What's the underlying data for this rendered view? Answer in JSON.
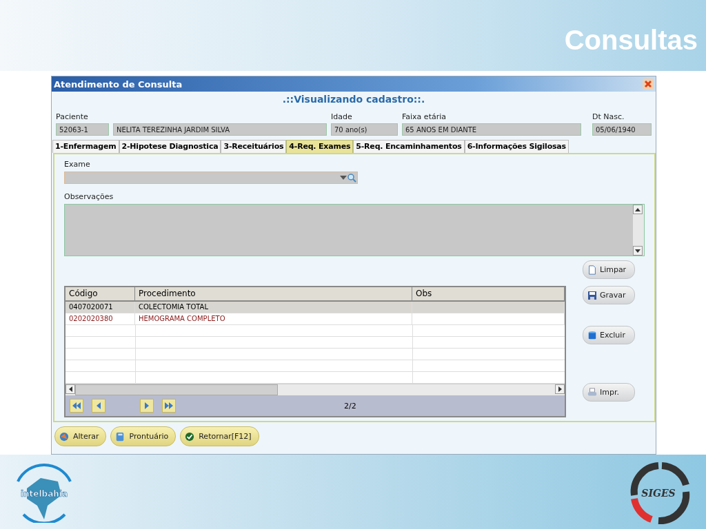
{
  "slide": {
    "title": "Consultas"
  },
  "window": {
    "title": "Atendimento de Consulta",
    "subtitle": ".::Visualizando cadastro::."
  },
  "patient": {
    "labels": {
      "patient": "Paciente",
      "age": "Idade",
      "age_group": "Faixa etária",
      "birth": "Dt Nasc."
    },
    "code": "52063-1",
    "name": "NELITA TEREZINHA JARDIM SILVA",
    "age": "70 ano(s)",
    "age_group": "65 ANOS EM DIANTE",
    "birth": "05/06/1940"
  },
  "tabs": [
    {
      "label": "1-Enfermagem",
      "selected": false
    },
    {
      "label": "2-Hipotese Diagnostica",
      "selected": false
    },
    {
      "label": "3-Receituários",
      "selected": false
    },
    {
      "label": "4-Req. Exames",
      "selected": true
    },
    {
      "label": "5-Req. Encaminhamentos",
      "selected": false
    },
    {
      "label": "6-Informações Sigilosas",
      "selected": false
    }
  ],
  "exam": {
    "label": "Exame"
  },
  "notes": {
    "label": "Observações"
  },
  "table": {
    "columns": [
      "Código",
      "Procedimento",
      "Obs"
    ],
    "rows": [
      {
        "code": "0407020071",
        "procedure": "COLECTOMIA TOTAL",
        "selected": true,
        "color": "#000000"
      },
      {
        "code": "0202020380",
        "procedure": "HEMOGRAMA COMPLETO",
        "selected": false,
        "color": "#8b1a1a"
      }
    ],
    "page": "2/2"
  },
  "side_buttons": [
    {
      "label": "Limpar",
      "kind": "new"
    },
    {
      "label": "Gravar",
      "kind": "save"
    },
    {
      "label": "Excluir",
      "kind": "delete"
    },
    {
      "label": "Impr.",
      "kind": "print"
    }
  ],
  "footer_buttons": [
    {
      "label": "Alterar",
      "kind": "edit"
    },
    {
      "label": "Prontuário",
      "kind": "record"
    },
    {
      "label": "Retornar[F12]",
      "kind": "confirm"
    }
  ],
  "logos": {
    "left": "intelbahia",
    "right": "SIGES"
  }
}
